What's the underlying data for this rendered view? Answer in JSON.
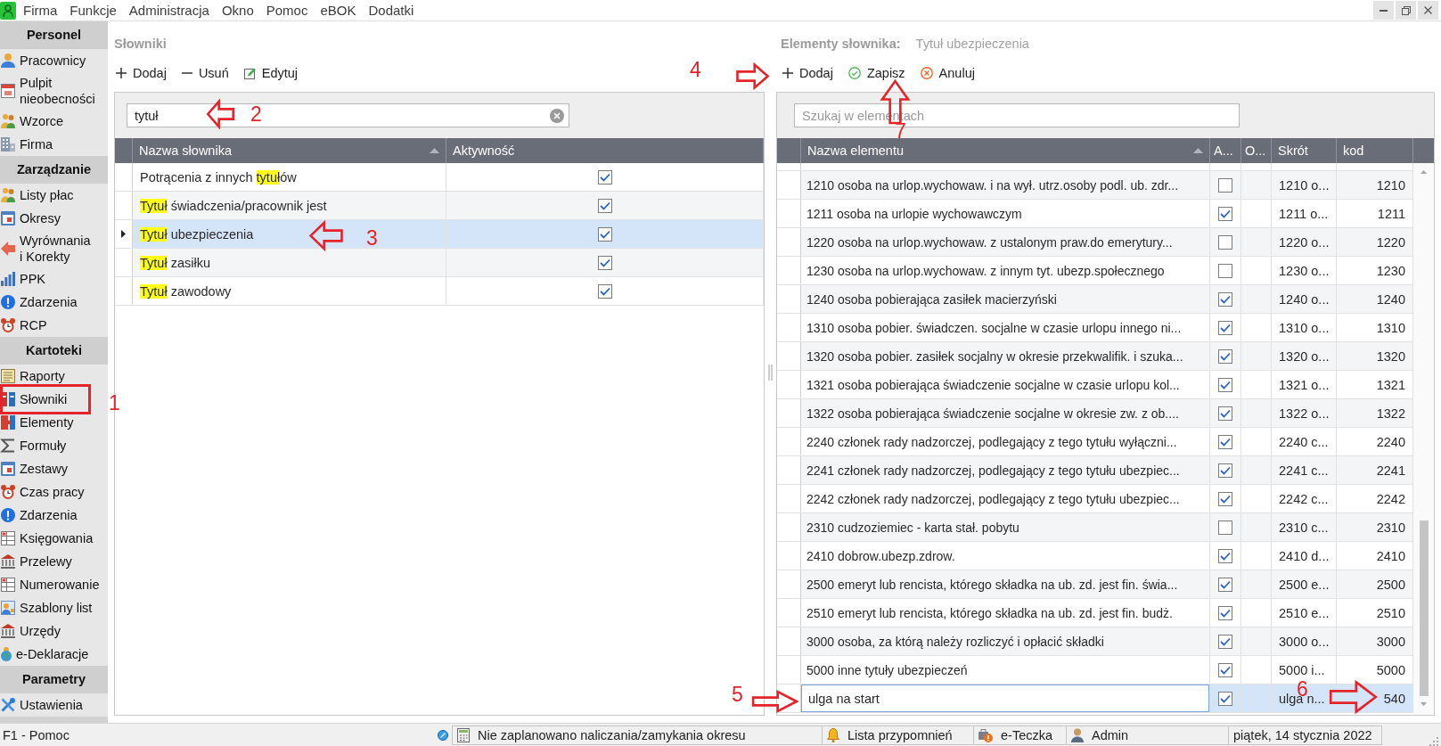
{
  "menu_bar": {
    "items": [
      "Firma",
      "Funkcje",
      "Administracja",
      "Okno",
      "Pomoc",
      "eBOK",
      "Dodatki"
    ]
  },
  "sidebar": {
    "sections": [
      {
        "title": "Personel",
        "items": [
          {
            "label": "Pracownicy",
            "selected": false
          },
          {
            "label": "Pulpit nieobecności",
            "selected": false
          },
          {
            "label": "Wzorce",
            "selected": false
          },
          {
            "label": "Firma",
            "selected": false
          }
        ]
      },
      {
        "title": "Zarządzanie",
        "items": [
          {
            "label": "Listy płac",
            "selected": false
          },
          {
            "label": "Okresy",
            "selected": false
          },
          {
            "label": "Wyrównania i Korekty",
            "selected": false
          },
          {
            "label": "PPK",
            "selected": false
          },
          {
            "label": "Zdarzenia",
            "selected": false
          },
          {
            "label": "RCP",
            "selected": false
          }
        ]
      },
      {
        "title": "Kartoteki",
        "items": [
          {
            "label": "Raporty",
            "selected": false
          },
          {
            "label": "Słowniki",
            "selected": false
          },
          {
            "label": "Elementy",
            "selected": false
          },
          {
            "label": "Formuły",
            "selected": false
          },
          {
            "label": "Zestawy",
            "selected": false
          },
          {
            "label": "Czas pracy",
            "selected": false
          },
          {
            "label": "Zdarzenia",
            "selected": false
          },
          {
            "label": "Księgowania",
            "selected": false
          },
          {
            "label": "Przelewy",
            "selected": false
          },
          {
            "label": "Numerowanie",
            "selected": false
          },
          {
            "label": "Szablony list",
            "selected": false
          },
          {
            "label": "Urzędy",
            "selected": false
          },
          {
            "label": "e-Deklaracje",
            "selected": false
          }
        ]
      },
      {
        "title": "Parametry",
        "items": [
          {
            "label": "Ustawienia",
            "selected": false
          }
        ]
      }
    ]
  },
  "dictionaries_panel": {
    "title": "Słowniki",
    "toolbar": [
      {
        "label": "Dodaj",
        "kind": "add"
      },
      {
        "label": "Usuń",
        "kind": "remove"
      },
      {
        "label": "Edytuj",
        "kind": "edit"
      }
    ],
    "search": {
      "value": "tytuł"
    },
    "table": {
      "columns": [
        {
          "label": "Nazwa słownika",
          "sorted": true
        },
        {
          "label": "Aktywność",
          "sorted": false
        }
      ],
      "rows": [
        {
          "name": [
            {
              "text": "Potrącenia z innych ",
              "highlight": false
            },
            {
              "text": "tytuł",
              "highlight": true
            },
            {
              "text": "ów",
              "highlight": false
            }
          ],
          "active": true,
          "selected": false
        },
        {
          "name": [
            {
              "text": "Tytuł",
              "highlight": true
            },
            {
              "text": " świadczenia/pracownik jest",
              "highlight": false
            }
          ],
          "active": true,
          "selected": false
        },
        {
          "name": [
            {
              "text": "Tytuł",
              "highlight": true
            },
            {
              "text": " ubezpieczenia",
              "highlight": false
            }
          ],
          "active": true,
          "selected": true
        },
        {
          "name": [
            {
              "text": "Tytuł",
              "highlight": true
            },
            {
              "text": " zasiłku",
              "highlight": false
            }
          ],
          "active": true,
          "selected": false
        },
        {
          "name": [
            {
              "text": "Tytuł",
              "highlight": true
            },
            {
              "text": " zawodowy",
              "highlight": false
            }
          ],
          "active": true,
          "selected": false
        }
      ]
    }
  },
  "elements_panel": {
    "title": "Elementy słownika:",
    "dictionary": "Tytuł ubezpieczenia",
    "toolbar": [
      {
        "label": "Dodaj",
        "kind": "add"
      },
      {
        "label": "Zapisz",
        "kind": "save"
      },
      {
        "label": "Anuluj",
        "kind": "cancel"
      }
    ],
    "search": {
      "placeholder": "Szukaj w elementach"
    },
    "table": {
      "columns": [
        {
          "label": "Nazwa elementu",
          "sorted": true
        },
        {
          "label": "A...",
          "sorted": false
        },
        {
          "label": "O...",
          "sorted": false
        },
        {
          "label": "Skrót",
          "sorted": false
        },
        {
          "label": "kod",
          "sorted": false
        }
      ],
      "rows": [
        {
          "name": "1210 osoba na urlop.wychowaw. i na wył. utrz.osoby podl. ub. zdr...",
          "active": false,
          "short": "1210 o...",
          "code": "1210",
          "selected": false,
          "editing": false
        },
        {
          "name": "1211 osoba na urlopie wychowawczym",
          "active": true,
          "short": "1211 o...",
          "code": "1211",
          "selected": false,
          "editing": false
        },
        {
          "name": "1220 osoba na urlop.wychowaw. z ustalonym praw.do emerytury...",
          "active": false,
          "short": "1220 o...",
          "code": "1220",
          "selected": false,
          "editing": false
        },
        {
          "name": "1230 osoba na urlop.wychowaw. z innym tyt. ubezp.społecznego",
          "active": false,
          "short": "1230 o...",
          "code": "1230",
          "selected": false,
          "editing": false
        },
        {
          "name": "1240 osoba pobierająca zasiłek macierzyński",
          "active": true,
          "short": "1240 o...",
          "code": "1240",
          "selected": false,
          "editing": false
        },
        {
          "name": "1310 osoba pobier. świadczen. socjalne w czasie urlopu innego ni...",
          "active": true,
          "short": "1310 o...",
          "code": "1310",
          "selected": false,
          "editing": false
        },
        {
          "name": "1320 osoba pobier. zasiłek socjalny w okresie przekwalifik. i szuka...",
          "active": true,
          "short": "1320 o...",
          "code": "1320",
          "selected": false,
          "editing": false
        },
        {
          "name": "1321 osoba pobierająca świadczenie socjalne w czasie urlopu kol...",
          "active": true,
          "short": "1321 o...",
          "code": "1321",
          "selected": false,
          "editing": false
        },
        {
          "name": "1322 osoba pobierająca świadczenie socjalne w okresie zw. z ob....",
          "active": true,
          "short": "1322 o...",
          "code": "1322",
          "selected": false,
          "editing": false
        },
        {
          "name": "2240 członek rady nadzorczej, podlegający z tego tytułu wyłączni...",
          "active": true,
          "short": "2240 c...",
          "code": "2240",
          "selected": false,
          "editing": false
        },
        {
          "name": "2241 członek rady nadzorczej, podlegający z tego tytułu ubezpiec...",
          "active": true,
          "short": "2241 c...",
          "code": "2241",
          "selected": false,
          "editing": false
        },
        {
          "name": "2242 członek rady nadzorczej, podlegający z tego tytułu ubezpiec...",
          "active": true,
          "short": "2242 c...",
          "code": "2242",
          "selected": false,
          "editing": false
        },
        {
          "name": "2310 cudzoziemiec - karta stał. pobytu",
          "active": false,
          "short": "2310 c...",
          "code": "2310",
          "selected": false,
          "editing": false
        },
        {
          "name": "2410 dobrow.ubezp.zdrow.",
          "active": true,
          "short": "2410 d...",
          "code": "2410",
          "selected": false,
          "editing": false
        },
        {
          "name": "2500 emeryt lub rencista, którego składka na ub. zd. jest fin. świa...",
          "active": true,
          "short": "2500 e...",
          "code": "2500",
          "selected": false,
          "editing": false
        },
        {
          "name": "2510 emeryt lub rencista, którego składka na ub. zd. jest fin. budż.",
          "active": true,
          "short": "2510 e...",
          "code": "2510",
          "selected": false,
          "editing": false
        },
        {
          "name": "3000 osoba, za którą należy rozliczyć i opłacić składki",
          "active": true,
          "short": "3000 o...",
          "code": "3000",
          "selected": false,
          "editing": false
        },
        {
          "name": "5000 inne tytuły ubezpieczeń",
          "active": true,
          "short": "5000 i...",
          "code": "5000",
          "selected": false,
          "editing": false
        },
        {
          "name": "ulga na start",
          "active": true,
          "short": "ulga n...",
          "code": "540",
          "selected": true,
          "editing": true
        }
      ]
    }
  },
  "status_bar": {
    "help": "F1 - Pomoc",
    "items": [
      {
        "kind": "schedule",
        "text": "Nie zaplanowano naliczania/zamykania okresu"
      },
      {
        "kind": "reminders",
        "text": "Lista przypomnień"
      },
      {
        "kind": "folder",
        "text": "e-Teczka"
      },
      {
        "kind": "user",
        "text": "Admin"
      },
      {
        "kind": "date",
        "text": "piątek, 14 stycznia 2022"
      }
    ]
  },
  "annotations": [
    {
      "kind": "box",
      "label": "1"
    },
    {
      "kind": "arrow-left",
      "label": "2"
    },
    {
      "kind": "arrow-left",
      "label": "3"
    },
    {
      "kind": "arrow-right",
      "label": "4"
    },
    {
      "kind": "arrow-right",
      "label": "5"
    },
    {
      "kind": "arrow-right",
      "label": "6"
    },
    {
      "kind": "arrow-up",
      "label": "7"
    }
  ]
}
